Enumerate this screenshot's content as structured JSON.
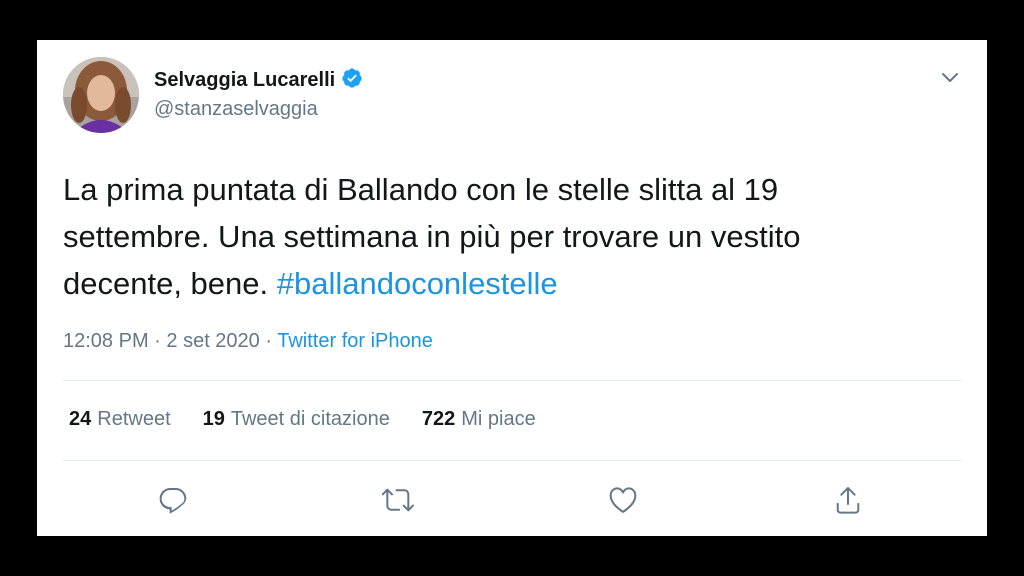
{
  "user": {
    "name": "Selvaggia Lucarelli",
    "handle": "@stanzaselvaggia",
    "verified": true
  },
  "tweet": {
    "lines": [
      "La prima puntata di Ballando con le stelle slitta al 19",
      "settembre. Una settimana in più per trovare un vestito",
      "decente, bene. "
    ],
    "hashtag": "#ballandoconlestelle",
    "time": "12:08 PM",
    "date": "2 set 2020",
    "source": "Twitter for iPhone"
  },
  "stats": {
    "retweets": {
      "count": "24",
      "label": "Retweet"
    },
    "quotes": {
      "count": "19",
      "label": "Tweet di citazione"
    },
    "likes": {
      "count": "722",
      "label": "Mi piace"
    }
  },
  "icons": {
    "reply": "reply-icon",
    "retweet": "retweet-icon",
    "like": "heart-icon",
    "share": "share-icon",
    "more": "chevron-down-icon",
    "verified": "verified-badge-icon"
  },
  "colors": {
    "link": "#1b95e0",
    "text": "#14171a",
    "secondary": "#657786",
    "verified": "#1da1f2"
  }
}
